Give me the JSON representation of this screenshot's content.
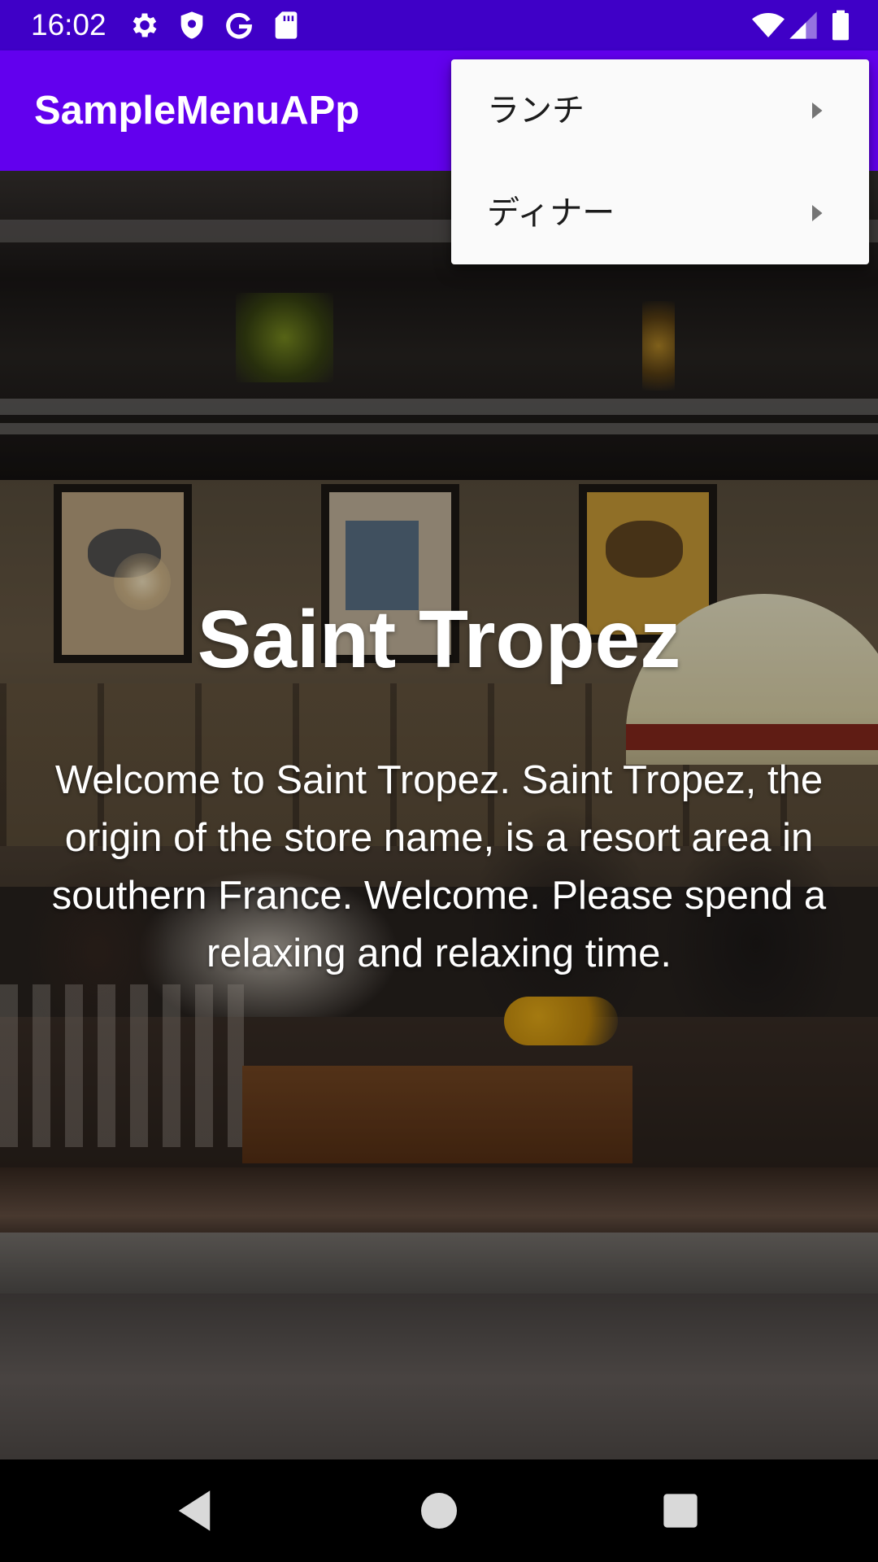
{
  "status_bar": {
    "time": "16:02",
    "icons": [
      "gear-icon",
      "shield-icon",
      "google-g-icon",
      "sd-card-icon",
      "wifi-icon",
      "signal-icon",
      "battery-icon"
    ]
  },
  "app_bar": {
    "title": "SampleMenuAPp",
    "color": "#6200ee"
  },
  "hero": {
    "title": "Saint Tropez",
    "body": "Welcome to Saint Tropez. Saint Tropez, the origin of the store name, is a resort area in southern France. Welcome. Please spend a relaxing and relaxing time."
  },
  "popup_menu": {
    "items": [
      {
        "label": "ランチ",
        "icon": "chevron-right-icon"
      },
      {
        "label": "ディナー",
        "icon": "chevron-right-icon"
      }
    ]
  },
  "nav_bar": {
    "buttons": [
      "back-icon",
      "home-icon",
      "recents-icon"
    ]
  },
  "colors": {
    "status_bar": "#3f00c7",
    "app_bar": "#6200ee",
    "menu_bg": "#fafafa"
  }
}
